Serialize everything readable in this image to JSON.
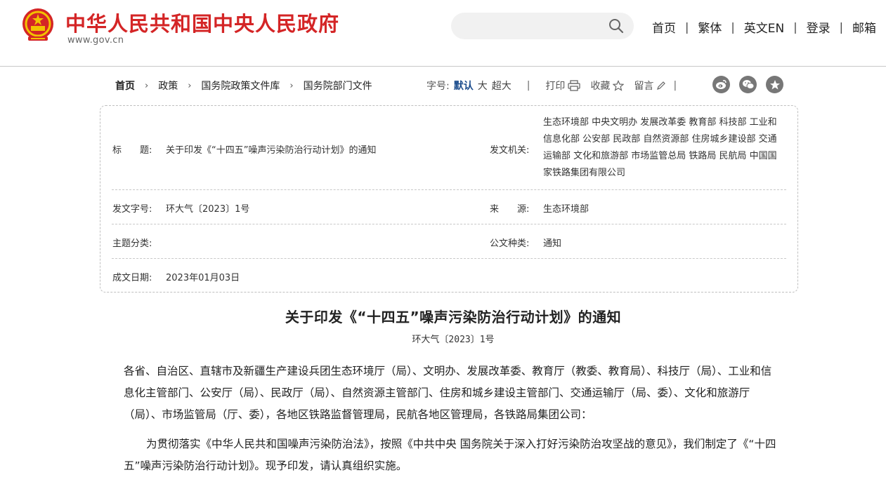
{
  "header": {
    "site_title": "中华人民共和国中央人民政府",
    "domain": "www.gov.cn",
    "nav": [
      "首页",
      "繁体",
      "英文EN",
      "登录",
      "邮箱"
    ]
  },
  "breadcrumb": [
    "首页",
    "政策",
    "国务院政策文件库",
    "国务院部门文件"
  ],
  "toolbar": {
    "font_size_label": "字号:",
    "font_sizes": [
      "默认",
      "大",
      "超大"
    ],
    "separator": "|",
    "print": "打印",
    "favorite": "收藏",
    "comment": "留言"
  },
  "info": {
    "title_label": "标　　题:",
    "title_value": "关于印发《“十四五”噪声污染防治行动计划》的通知",
    "issuer_label": "发文机关:",
    "issuer_value": "生态环境部 中央文明办 发展改革委 教育部 科技部 工业和信息化部 公安部 民政部 自然资源部 住房城乡建设部 交通运输部 文化和旅游部 市场监管总局 铁路局 民航局 中国国家铁路集团有限公司",
    "docno_label": "发文字号:",
    "docno_value": "环大气〔2023〕1号",
    "source_label": "来　　源:",
    "source_value": "生态环境部",
    "topic_label": "主题分类:",
    "topic_value": "",
    "type_label": "公文种类:",
    "type_value": "通知",
    "date_label": "成文日期:",
    "date_value": "2023年01月03日"
  },
  "document": {
    "title": "关于印发《“十四五”噪声污染防治行动计划》的通知",
    "number": "环大气〔2023〕1号",
    "addressee": "各省、自治区、直辖市及新疆生产建设兵团生态环境厅（局）、文明办、发展改革委、教育厅（教委、教育局）、科技厅（局）、工业和信息化主管部门、公安厅（局）、民政厅（局）、自然资源主管部门、住房和城乡建设主管部门、交通运输厅（局、委）、文化和旅游厅（局）、市场监管局（厅、委），各地区铁路监督管理局，民航各地区管理局，各铁路局集团公司：",
    "paragraph1": "为贯彻落实《中华人民共和国噪声污染防治法》，按照《中共中央 国务院关于深入打好污染防治攻坚战的意见》，我们制定了《“十四五”噪声污染防治行动计划》。现予印发，请认真组织实施。"
  },
  "colors": {
    "brand_red": "#d42526",
    "link_blue": "#1a4b8c",
    "icon_gray": "#777777"
  },
  "icons": [
    "national-emblem-icon",
    "search-icon",
    "print-icon",
    "star-icon",
    "pencil-icon",
    "weibo-icon",
    "wechat-icon",
    "qzone-icon"
  ]
}
